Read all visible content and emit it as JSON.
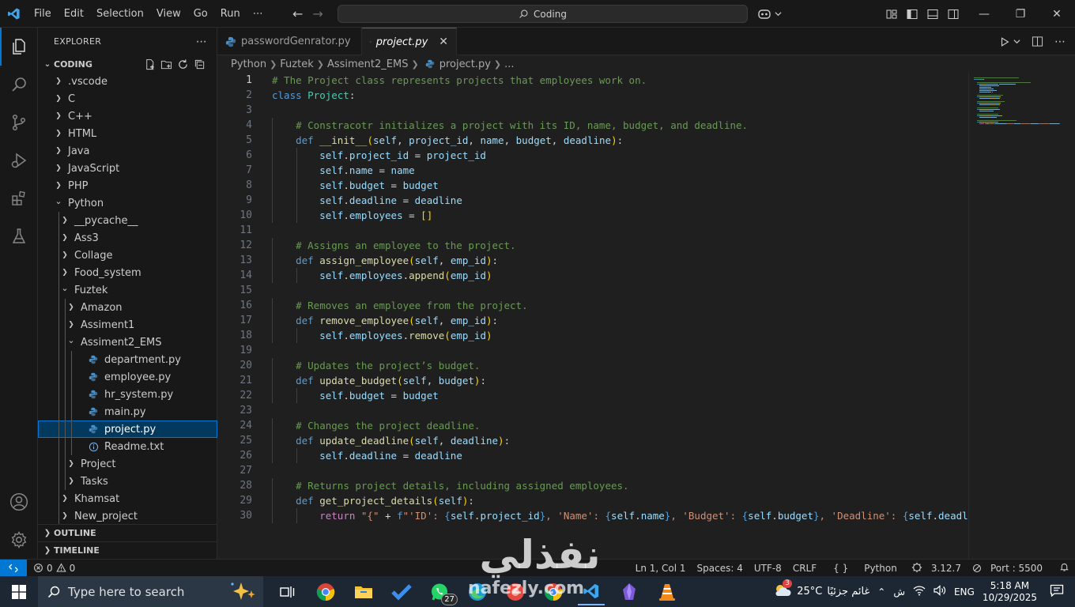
{
  "titlebar": {
    "menu": [
      "File",
      "Edit",
      "Selection",
      "View",
      "Go",
      "Run",
      "⋯"
    ],
    "search_text": "Coding"
  },
  "explorer": {
    "title": "EXPLORER",
    "more": "⋯",
    "root": "CODING",
    "items": [
      {
        "label": ".vscode",
        "type": "folder",
        "depth": 0,
        "open": false
      },
      {
        "label": "C",
        "type": "folder",
        "depth": 0,
        "open": false
      },
      {
        "label": "C++",
        "type": "folder",
        "depth": 0,
        "open": false
      },
      {
        "label": "HTML",
        "type": "folder",
        "depth": 0,
        "open": false
      },
      {
        "label": "Java",
        "type": "folder",
        "depth": 0,
        "open": false
      },
      {
        "label": "JavaScript",
        "type": "folder",
        "depth": 0,
        "open": false
      },
      {
        "label": "PHP",
        "type": "folder",
        "depth": 0,
        "open": false
      },
      {
        "label": "Python",
        "type": "folder",
        "depth": 0,
        "open": true
      },
      {
        "label": "__pycache__",
        "type": "folder",
        "depth": 1,
        "open": false
      },
      {
        "label": "Ass3",
        "type": "folder",
        "depth": 1,
        "open": false
      },
      {
        "label": "Collage",
        "type": "folder",
        "depth": 1,
        "open": false
      },
      {
        "label": "Food_system",
        "type": "folder",
        "depth": 1,
        "open": false
      },
      {
        "label": "Fuztek",
        "type": "folder",
        "depth": 1,
        "open": true
      },
      {
        "label": "Amazon",
        "type": "folder",
        "depth": 2,
        "open": false
      },
      {
        "label": "Assiment1",
        "type": "folder",
        "depth": 2,
        "open": false
      },
      {
        "label": "Assiment2_EMS",
        "type": "folder",
        "depth": 2,
        "open": true
      },
      {
        "label": "department.py",
        "type": "py",
        "depth": 3
      },
      {
        "label": "employee.py",
        "type": "py",
        "depth": 3
      },
      {
        "label": "hr_system.py",
        "type": "py",
        "depth": 3
      },
      {
        "label": "main.py",
        "type": "py",
        "depth": 3
      },
      {
        "label": "project.py",
        "type": "py",
        "depth": 3,
        "selected": true
      },
      {
        "label": "Readme.txt",
        "type": "txt",
        "depth": 3
      },
      {
        "label": "Project",
        "type": "folder",
        "depth": 2,
        "open": false
      },
      {
        "label": "Tasks",
        "type": "folder",
        "depth": 2,
        "open": false
      },
      {
        "label": "Khamsat",
        "type": "folder",
        "depth": 1,
        "open": false
      },
      {
        "label": "New_project",
        "type": "folder",
        "depth": 1,
        "open": false
      }
    ],
    "outline": "OUTLINE",
    "timeline": "TIMELINE"
  },
  "tabs": [
    {
      "label": "passwordGenrator.py",
      "active": false
    },
    {
      "label": "project.py",
      "active": true
    }
  ],
  "tab_close": "✕",
  "breadcrumb": [
    "Python",
    "Fuztek",
    "Assiment2_EMS",
    "project.py",
    "..."
  ],
  "editor": {
    "current_line": 1,
    "lines": [
      [
        [
          "cm",
          "# The Project class represents projects that employees work on."
        ]
      ],
      [
        [
          "kw",
          "class "
        ],
        [
          "cls",
          "Project"
        ],
        [
          "op",
          ":"
        ]
      ],
      [],
      [
        [
          "sp",
          "    "
        ],
        [
          "cm",
          "# Constracotr initializes a project with its ID, name, budget, and deadline."
        ]
      ],
      [
        [
          "sp",
          "    "
        ],
        [
          "kw",
          "def "
        ],
        [
          "fn",
          "__init__"
        ],
        [
          "br",
          "("
        ],
        [
          "var",
          "self"
        ],
        [
          "op",
          ", "
        ],
        [
          "var",
          "project_id"
        ],
        [
          "op",
          ", "
        ],
        [
          "var",
          "name"
        ],
        [
          "op",
          ", "
        ],
        [
          "var",
          "budget"
        ],
        [
          "op",
          ", "
        ],
        [
          "var",
          "deadline"
        ],
        [
          "br",
          ")"
        ],
        [
          "op",
          ":"
        ]
      ],
      [
        [
          "sp",
          "        "
        ],
        [
          "var",
          "self"
        ],
        [
          "op",
          "."
        ],
        [
          "var",
          "project_id"
        ],
        [
          "op",
          " = "
        ],
        [
          "var",
          "project_id"
        ]
      ],
      [
        [
          "sp",
          "        "
        ],
        [
          "var",
          "self"
        ],
        [
          "op",
          "."
        ],
        [
          "var",
          "name"
        ],
        [
          "op",
          " = "
        ],
        [
          "var",
          "name"
        ]
      ],
      [
        [
          "sp",
          "        "
        ],
        [
          "var",
          "self"
        ],
        [
          "op",
          "."
        ],
        [
          "var",
          "budget"
        ],
        [
          "op",
          " = "
        ],
        [
          "var",
          "budget"
        ]
      ],
      [
        [
          "sp",
          "        "
        ],
        [
          "var",
          "self"
        ],
        [
          "op",
          "."
        ],
        [
          "var",
          "deadline"
        ],
        [
          "op",
          " = "
        ],
        [
          "var",
          "deadline"
        ]
      ],
      [
        [
          "sp",
          "        "
        ],
        [
          "var",
          "self"
        ],
        [
          "op",
          "."
        ],
        [
          "var",
          "employees"
        ],
        [
          "op",
          " = "
        ],
        [
          "br",
          "[]"
        ]
      ],
      [],
      [
        [
          "sp",
          "    "
        ],
        [
          "cm",
          "# Assigns an employee to the project."
        ]
      ],
      [
        [
          "sp",
          "    "
        ],
        [
          "kw",
          "def "
        ],
        [
          "fn",
          "assign_employee"
        ],
        [
          "br",
          "("
        ],
        [
          "var",
          "self"
        ],
        [
          "op",
          ", "
        ],
        [
          "var",
          "emp_id"
        ],
        [
          "br",
          ")"
        ],
        [
          "op",
          ":"
        ]
      ],
      [
        [
          "sp",
          "        "
        ],
        [
          "var",
          "self"
        ],
        [
          "op",
          "."
        ],
        [
          "var",
          "employees"
        ],
        [
          "op",
          "."
        ],
        [
          "fn",
          "append"
        ],
        [
          "br",
          "("
        ],
        [
          "var",
          "emp_id"
        ],
        [
          "br",
          ")"
        ]
      ],
      [],
      [
        [
          "sp",
          "    "
        ],
        [
          "cm",
          "# Removes an employee from the project."
        ]
      ],
      [
        [
          "sp",
          "    "
        ],
        [
          "kw",
          "def "
        ],
        [
          "fn",
          "remove_employee"
        ],
        [
          "br",
          "("
        ],
        [
          "var",
          "self"
        ],
        [
          "op",
          ", "
        ],
        [
          "var",
          "emp_id"
        ],
        [
          "br",
          ")"
        ],
        [
          "op",
          ":"
        ]
      ],
      [
        [
          "sp",
          "        "
        ],
        [
          "var",
          "self"
        ],
        [
          "op",
          "."
        ],
        [
          "var",
          "employees"
        ],
        [
          "op",
          "."
        ],
        [
          "fn",
          "remove"
        ],
        [
          "br",
          "("
        ],
        [
          "var",
          "emp_id"
        ],
        [
          "br",
          ")"
        ]
      ],
      [],
      [
        [
          "sp",
          "    "
        ],
        [
          "cm",
          "# Updates the project’s budget."
        ]
      ],
      [
        [
          "sp",
          "    "
        ],
        [
          "kw",
          "def "
        ],
        [
          "fn",
          "update_budget"
        ],
        [
          "br",
          "("
        ],
        [
          "var",
          "self"
        ],
        [
          "op",
          ", "
        ],
        [
          "var",
          "budget"
        ],
        [
          "br",
          ")"
        ],
        [
          "op",
          ":"
        ]
      ],
      [
        [
          "sp",
          "        "
        ],
        [
          "var",
          "self"
        ],
        [
          "op",
          "."
        ],
        [
          "var",
          "budget"
        ],
        [
          "op",
          " = "
        ],
        [
          "var",
          "budget"
        ]
      ],
      [],
      [
        [
          "sp",
          "    "
        ],
        [
          "cm",
          "# Changes the project deadline."
        ]
      ],
      [
        [
          "sp",
          "    "
        ],
        [
          "kw",
          "def "
        ],
        [
          "fn",
          "update_deadline"
        ],
        [
          "br",
          "("
        ],
        [
          "var",
          "self"
        ],
        [
          "op",
          ", "
        ],
        [
          "var",
          "deadline"
        ],
        [
          "br",
          ")"
        ],
        [
          "op",
          ":"
        ]
      ],
      [
        [
          "sp",
          "        "
        ],
        [
          "var",
          "self"
        ],
        [
          "op",
          "."
        ],
        [
          "var",
          "deadline"
        ],
        [
          "op",
          " = "
        ],
        [
          "var",
          "deadline"
        ]
      ],
      [],
      [
        [
          "sp",
          "    "
        ],
        [
          "cm",
          "# Returns project details, including assigned employees."
        ]
      ],
      [
        [
          "sp",
          "    "
        ],
        [
          "kw",
          "def "
        ],
        [
          "fn",
          "get_project_details"
        ],
        [
          "br",
          "("
        ],
        [
          "var",
          "self"
        ],
        [
          "br",
          ")"
        ],
        [
          "op",
          ":"
        ]
      ],
      [
        [
          "sp",
          "        "
        ],
        [
          "ctl",
          "return "
        ],
        [
          "str",
          "\"{\""
        ],
        [
          "op",
          " + "
        ],
        [
          "kw",
          "f"
        ],
        [
          "str",
          "\"'ID': "
        ],
        [
          "kw",
          "{"
        ],
        [
          "var",
          "self"
        ],
        [
          "op",
          "."
        ],
        [
          "var",
          "project_id"
        ],
        [
          "kw",
          "}"
        ],
        [
          "str",
          ", 'Name': "
        ],
        [
          "kw",
          "{"
        ],
        [
          "var",
          "self"
        ],
        [
          "op",
          "."
        ],
        [
          "var",
          "name"
        ],
        [
          "kw",
          "}"
        ],
        [
          "str",
          ", 'Budget': "
        ],
        [
          "kw",
          "{"
        ],
        [
          "var",
          "self"
        ],
        [
          "op",
          "."
        ],
        [
          "var",
          "budget"
        ],
        [
          "kw",
          "}"
        ],
        [
          "str",
          ", 'Deadline': "
        ],
        [
          "kw",
          "{"
        ],
        [
          "var",
          "self"
        ],
        [
          "op",
          "."
        ],
        [
          "var",
          "deadline"
        ],
        [
          "kw",
          "}"
        ]
      ]
    ]
  },
  "statusbar": {
    "errors": "0",
    "warnings": "0",
    "position": "Ln 1, Col 1",
    "spaces": "Spaces: 4",
    "encoding": "UTF-8",
    "eol": "CRLF",
    "language": "Python",
    "interpreter": "3.12.7",
    "port": "Port : 5500"
  },
  "taskbar": {
    "search_placeholder": "Type here to search",
    "whatsapp_badge": "27",
    "weather_badge": "3",
    "temperature": "25°C",
    "weather_text": "غائم جزئيًا",
    "language": "ENG",
    "time": "5:18 AM",
    "date": "10/29/2025"
  },
  "watermark": {
    "arabic": "نفذلي",
    "latin": "nafezly.com"
  }
}
